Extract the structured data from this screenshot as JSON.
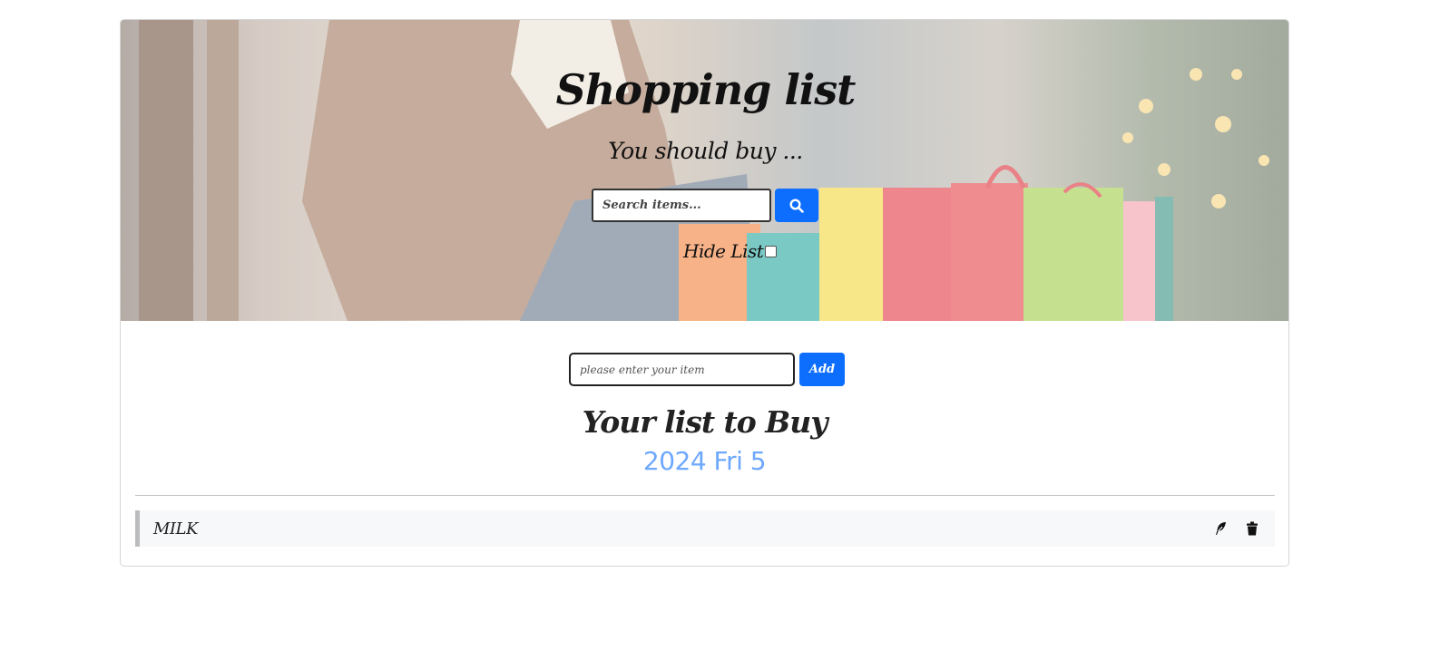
{
  "hero": {
    "title": "Shopping list",
    "subtitle": "You should buy ...",
    "search_placeholder": "Search items...",
    "search_icon": "search-icon",
    "hide_list_label": "Hide List",
    "hide_list_checked": false
  },
  "add_form": {
    "input_placeholder": "please enter your item",
    "add_label": "Add"
  },
  "list": {
    "title": "Your list to Buy",
    "date": "2024 Fri 5",
    "items": [
      {
        "name": "MILK",
        "edit_icon": "feather-edit-icon",
        "delete_icon": "trash-icon"
      }
    ]
  },
  "colors": {
    "accent": "#0d6efd",
    "date_text": "#6ea8fe",
    "item_bg": "#f7f8f9"
  }
}
